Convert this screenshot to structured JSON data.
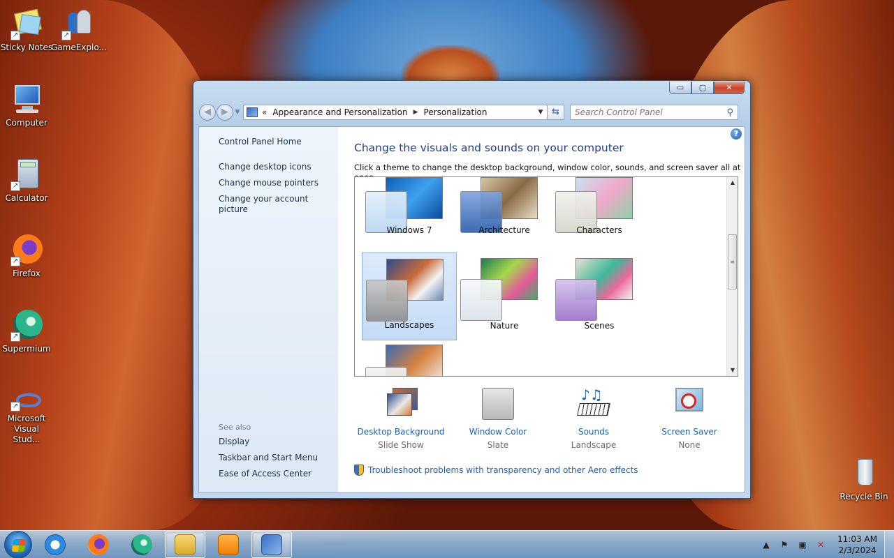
{
  "desktop": {
    "icons": [
      {
        "label": "Sticky Notes",
        "icon": "sticky-notes-icon"
      },
      {
        "label": "GameExplo...",
        "icon": "game-explorer-icon"
      },
      {
        "label": "Computer",
        "icon": "computer-icon"
      },
      {
        "label": "Calculator",
        "icon": "calculator-icon"
      },
      {
        "label": "Firefox",
        "icon": "firefox-icon"
      },
      {
        "label": "Supermium",
        "icon": "supermium-icon"
      },
      {
        "label": "Microsoft Visual Stud...",
        "icon": "visual-studio-icon"
      },
      {
        "label": "Recycle Bin",
        "icon": "recycle-bin-icon"
      }
    ]
  },
  "window": {
    "caption_buttons": {
      "minimize": "▭",
      "maximize": "▢",
      "close": "✕"
    },
    "address": {
      "prefix": "«",
      "crumbs": [
        "Appearance and Personalization",
        "Personalization"
      ]
    },
    "search": {
      "placeholder": "Search Control Panel"
    },
    "left_pane": {
      "home": "Control Panel Home",
      "tasks": [
        "Change desktop icons",
        "Change mouse pointers",
        "Change your account picture"
      ],
      "see_also_header": "See also",
      "see_also": [
        "Display",
        "Taskbar and Start Menu",
        "Ease of Access Center"
      ]
    },
    "main": {
      "title": "Change the visuals and sounds on your computer",
      "subtitle": "Click a theme to change the desktop background, window color, sounds, and screen saver all at once.",
      "themes": [
        {
          "name": "Windows 7",
          "selected": false,
          "color": "#cfe3f6"
        },
        {
          "name": "Architecture",
          "selected": false,
          "color": "#4d7fc9"
        },
        {
          "name": "Characters",
          "selected": false,
          "color": "#e4e4dc"
        },
        {
          "name": "Landscapes",
          "selected": true,
          "color": "#9c9c9c"
        },
        {
          "name": "Nature",
          "selected": false,
          "color": "#e8eef4"
        },
        {
          "name": "Scenes",
          "selected": false,
          "color": "#b391d8"
        }
      ],
      "settings": [
        {
          "title": "Desktop Background",
          "sub": "Slide Show",
          "icon": "desktop-background-icon"
        },
        {
          "title": "Window Color",
          "sub": "Slate",
          "icon": "window-color-icon"
        },
        {
          "title": "Sounds",
          "sub": "Landscape",
          "icon": "sounds-icon"
        },
        {
          "title": "Screen Saver",
          "sub": "None",
          "icon": "screen-saver-icon"
        }
      ],
      "troubleshoot_link": "Troubleshoot problems with transparency and other Aero effects"
    }
  },
  "taskbar": {
    "pinned": [
      "internet-explorer-icon",
      "firefox-icon",
      "supermium-icon",
      "windows-explorer-icon",
      "media-player-icon",
      "control-panel-icon"
    ],
    "clock": {
      "time": "11:03 AM",
      "date": "2/3/2024"
    }
  }
}
